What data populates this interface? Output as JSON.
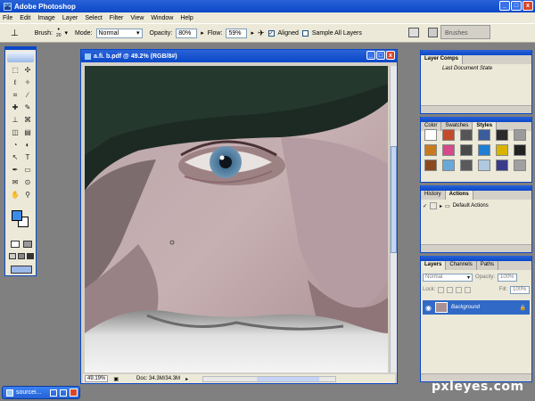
{
  "app": {
    "title": "Adobe Photoshop",
    "ps_glyph": "Ps"
  },
  "window_controls": {
    "minimize": "_",
    "maximize": "□",
    "close": "x"
  },
  "menu": [
    "File",
    "Edit",
    "Image",
    "Layer",
    "Select",
    "Filter",
    "View",
    "Window",
    "Help"
  ],
  "options": {
    "brush_label": "Brush:",
    "brush_size": "20",
    "mode_label": "Mode:",
    "mode_value": "Normal",
    "opacity_label": "Opacity:",
    "opacity_value": "80%",
    "flow_label": "Flow:",
    "flow_value": "59%",
    "aligned_label": "Aligned",
    "aligned_checked": true,
    "sample_all_label": "Sample All Layers",
    "brushes_tab": "Brushes"
  },
  "toolbox": {
    "tools": [
      {
        "glyph": "⬚",
        "name": "marquee-tool-icon"
      },
      {
        "glyph": "✣",
        "name": "move-tool-icon"
      },
      {
        "glyph": "ℓ",
        "name": "lasso-tool-icon"
      },
      {
        "glyph": "✧",
        "name": "magic-wand-tool-icon"
      },
      {
        "glyph": "⌗",
        "name": "crop-tool-icon"
      },
      {
        "glyph": "∕",
        "name": "slice-tool-icon"
      },
      {
        "glyph": "✚",
        "name": "healing-brush-tool-icon"
      },
      {
        "glyph": "✎",
        "name": "brush-tool-icon"
      },
      {
        "glyph": "⊥",
        "name": "clone-stamp-tool-icon"
      },
      {
        "glyph": "⌘",
        "name": "history-brush-tool-icon"
      },
      {
        "glyph": "◫",
        "name": "eraser-tool-icon"
      },
      {
        "glyph": "▤",
        "name": "gradient-tool-icon"
      },
      {
        "glyph": "◔",
        "name": "blur-tool-icon"
      },
      {
        "glyph": "◐",
        "name": "dodge-tool-icon"
      },
      {
        "glyph": "↖",
        "name": "path-selection-tool-icon"
      },
      {
        "glyph": "T",
        "name": "type-tool-icon"
      },
      {
        "glyph": "✒",
        "name": "pen-tool-icon"
      },
      {
        "glyph": "▭",
        "name": "shape-tool-icon"
      },
      {
        "glyph": "✉",
        "name": "notes-tool-icon"
      },
      {
        "glyph": "⊙",
        "name": "eyedropper-tool-icon"
      },
      {
        "glyph": "✋",
        "name": "hand-tool-icon"
      },
      {
        "glyph": "⚲",
        "name": "zoom-tool-icon"
      }
    ],
    "foreground_color": "#3c8ce6",
    "background_color": "#ffffff"
  },
  "document": {
    "title": "a.fi. b.pdf @ 49.2% (RGB/8#)",
    "zoom": "49.19%",
    "doc_info": "Doc: 34.3M/34.3M"
  },
  "panels": {
    "layer_comps": {
      "tab": "Layer Comps",
      "item": "Last Document State"
    },
    "styles": {
      "tabs": [
        "Color",
        "Swatches",
        "Styles"
      ],
      "active": "Styles",
      "swatches": [
        "#ffffff",
        "#c44b2a",
        "#555555",
        "#3a5d9c",
        "#2b2b2b",
        "#9b9b9b",
        "#c87a1e",
        "#d44a8a",
        "#4a4a4a",
        "#1f7fd4",
        "#d8b400",
        "#222222",
        "#8a4a1e",
        "#6aa8d8",
        "#5a5a5a",
        "#b0c8e0",
        "#3a3a8a",
        "#a0a0a0"
      ]
    },
    "actions": {
      "tabs": [
        "History",
        "Actions"
      ],
      "active": "Actions",
      "item": "Default Actions"
    },
    "layers": {
      "tabs": [
        "Layers",
        "Channels",
        "Paths"
      ],
      "active": "Layers",
      "blend_mode": "Normal",
      "opacity_label": "Opacity:",
      "opacity": "100%",
      "lock_label": "Lock:",
      "fill_label": "Fill:",
      "fill": "100%",
      "layer_name": "Background"
    }
  },
  "taskbar": {
    "label": "sourcei..."
  },
  "watermark": "pxleyes.com"
}
